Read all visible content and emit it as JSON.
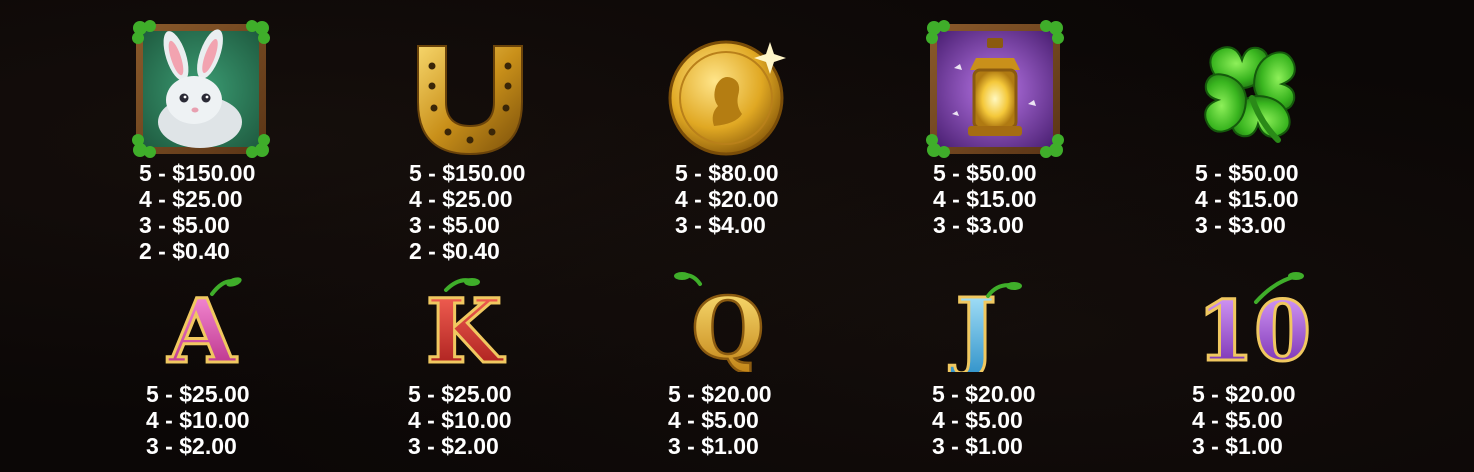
{
  "paytable": {
    "symbols": [
      {
        "id": "rabbit",
        "icon": "white-rabbit-icon",
        "pays": [
          "5 - $150.00",
          "4 - $25.00",
          "3 - $5.00",
          "2 - $0.40"
        ]
      },
      {
        "id": "horseshoe",
        "icon": "golden-horseshoe-icon",
        "pays": [
          "5 - $150.00",
          "4 - $25.00",
          "3 - $5.00",
          "2 - $0.40"
        ]
      },
      {
        "id": "coin",
        "icon": "gold-coin-icon",
        "pays": [
          "5 - $80.00",
          "4 - $20.00",
          "3 - $4.00"
        ]
      },
      {
        "id": "lantern",
        "icon": "lantern-icon",
        "pays": [
          "5 - $50.00",
          "4 - $15.00",
          "3 - $3.00"
        ]
      },
      {
        "id": "clover",
        "icon": "four-leaf-clover-icon",
        "pays": [
          "5 - $50.00",
          "4 - $15.00",
          "3 - $3.00"
        ]
      },
      {
        "id": "a",
        "icon": "letter-a-icon",
        "pays": [
          "5 - $25.00",
          "4 - $10.00",
          "3 - $2.00"
        ]
      },
      {
        "id": "k",
        "icon": "letter-k-icon",
        "pays": [
          "5 - $25.00",
          "4 - $10.00",
          "3 - $2.00"
        ]
      },
      {
        "id": "q",
        "icon": "letter-q-icon",
        "pays": [
          "5 - $20.00",
          "4 - $5.00",
          "3 - $1.00"
        ]
      },
      {
        "id": "j",
        "icon": "letter-j-icon",
        "pays": [
          "5 - $20.00",
          "4 - $5.00",
          "3 - $1.00"
        ]
      },
      {
        "id": "ten",
        "icon": "number-10-icon",
        "pays": [
          "5 - $20.00",
          "4 - $5.00",
          "3 - $1.00"
        ]
      }
    ]
  },
  "letters": {
    "a": "A",
    "k": "K",
    "q": "Q",
    "j": "J",
    "ten": "10"
  },
  "colors": {
    "background": "#0b0706",
    "text": "#ffffff",
    "gold": "#d9a21b",
    "pink": "#e04fb0",
    "red": "#d82d2d",
    "cyan": "#4fc3ea",
    "purple": "#9b45d6",
    "green": "#3fae2a"
  }
}
